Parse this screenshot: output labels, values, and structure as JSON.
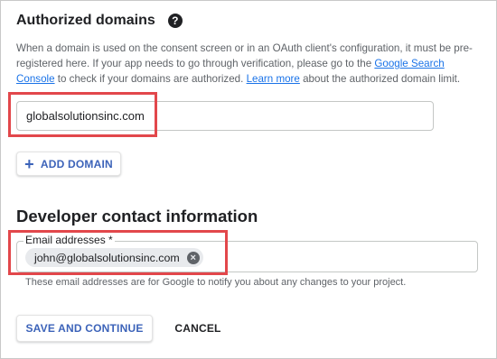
{
  "authorized_domains": {
    "title": "Authorized domains",
    "help_icon": "question-circle-icon",
    "description": {
      "text_1": "When a domain is used on the consent screen or in an OAuth client's configuration, it must be pre-registered here. If your app needs to go through verification, please go to the ",
      "link_search_console": "Google Search Console",
      "text_2": " to check if your domains are authorized. ",
      "link_learn_more": "Learn more",
      "text_3": " about the authorized domain limit."
    },
    "domain_value": "globalsolutionsinc.com",
    "add_domain_icon": "plus-icon",
    "add_domain_label": "ADD DOMAIN"
  },
  "developer_contact": {
    "title": "Developer contact information",
    "email_label": "Email addresses *",
    "email_chip": "john@globalsolutionsinc.com",
    "chip_remove_icon": "close-circle-icon",
    "helper_text": "These email addresses are for Google to notify you about any changes to your project."
  },
  "actions": {
    "save_label": "SAVE AND CONTINUE",
    "cancel_label": "CANCEL"
  },
  "colors": {
    "accent": "#3c63b9",
    "link": "#1a73e8",
    "highlight": "#e2474b",
    "chip_bg": "#e8eaed"
  }
}
